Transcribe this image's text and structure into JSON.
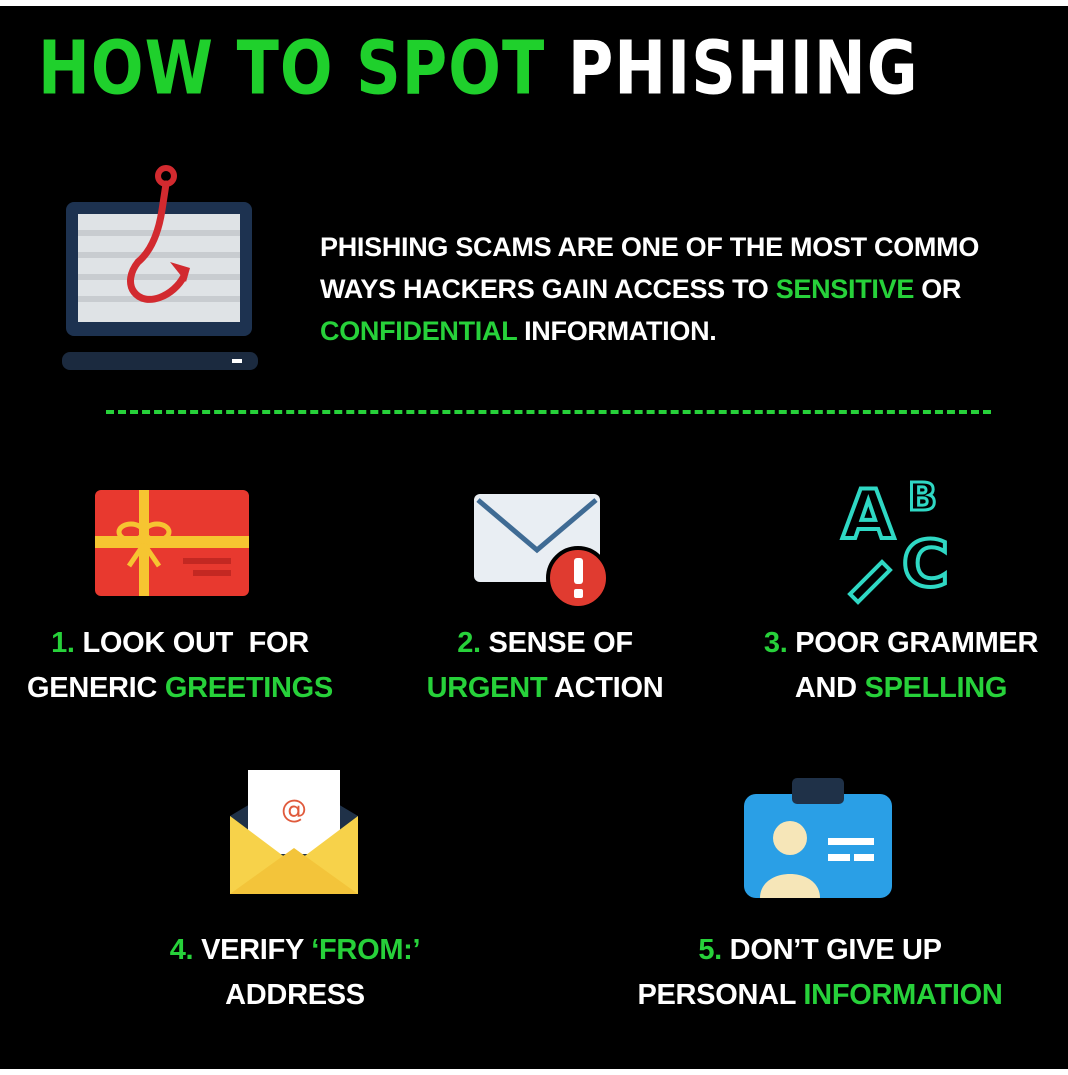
{
  "title": {
    "part1": "HOW TO SPOT",
    "part2": "PHISHING"
  },
  "intro": {
    "line1": "PHISHING SCAMS ARE ONE OF THE MOST COMMO",
    "line2_a": "WAYS HACKERS GAIN ACCESS TO",
    "line2_hl": "SENSITIVE",
    "line2_b": "OR",
    "line3_hl": "CONFIDENTIAL",
    "line3_b": "INFORMATION."
  },
  "tips": [
    {
      "num": "1.",
      "l1": "LOOK OUT  FOR",
      "l2a": "GENERIC",
      "l2hl": "GREETINGS",
      "icon": "gift-card-icon"
    },
    {
      "num": "2.",
      "l1": "SENSE OF",
      "l2hl": "URGENT",
      "l2b": "ACTION",
      "icon": "urgent-mail-icon"
    },
    {
      "num": "3.",
      "l1": "POOR GRAMMER",
      "l2a": "AND",
      "l2hl": "SPELLING",
      "icon": "abc-spelling-icon"
    },
    {
      "num": "4.",
      "l1a": "VERIFY",
      "l1hl": "‘FROM:’",
      "l2": "ADDRESS",
      "icon": "email-at-envelope-icon"
    },
    {
      "num": "5.",
      "l1": "DON’T GIVE UP",
      "l2a": "PERSONAL",
      "l2hl": "INFORMATION",
      "icon": "id-badge-icon"
    }
  ],
  "icon_glyphs": {
    "at_sign": "@",
    "letter_a": "A",
    "letter_b": "B",
    "letter_c": "C"
  },
  "colors": {
    "background": "#000000",
    "accent_green": "#27d13a",
    "text": "#ffffff"
  }
}
